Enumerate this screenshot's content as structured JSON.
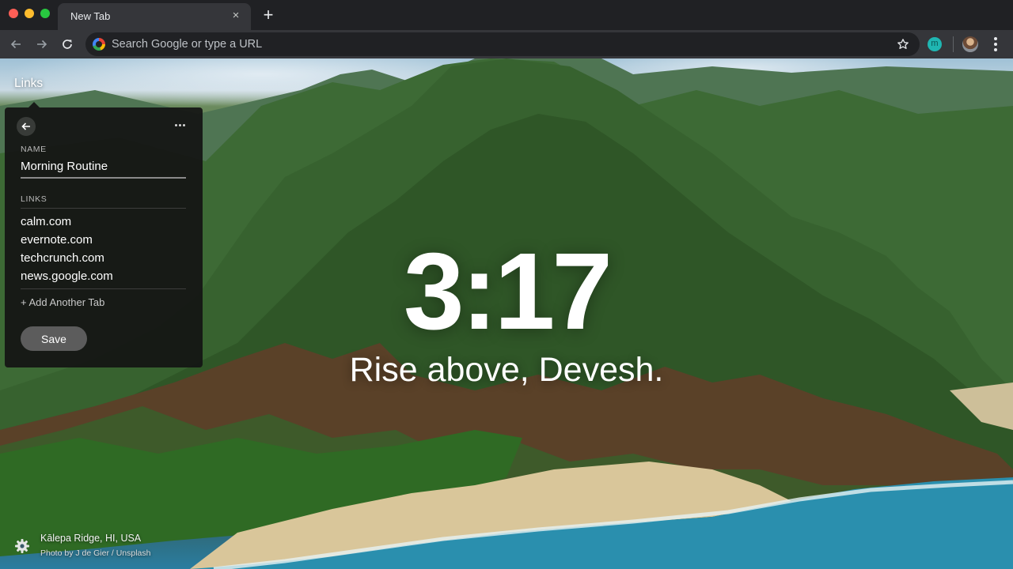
{
  "browser": {
    "tab": {
      "title": "New Tab",
      "close_glyph": "×"
    },
    "new_tab_glyph": "+",
    "omnibox": {
      "placeholder": "Search Google or type a URL",
      "value": ""
    },
    "extension_letter": "m",
    "icons": {
      "back": "arrow-left-icon",
      "forward": "arrow-right-icon",
      "reload": "reload-icon",
      "bookmark": "star-icon",
      "menu": "kebab-menu-icon"
    },
    "colors": {
      "tabstrip": "#202124",
      "toolbar": "#35363a",
      "extension": "#1fb6b2"
    }
  },
  "links_widget": {
    "label": "Links",
    "name_section_label": "NAME",
    "name_value": "Morning Routine",
    "links_section_label": "LINKS",
    "links": [
      {
        "label": "calm.com"
      },
      {
        "label": "evernote.com"
      },
      {
        "label": "techcrunch.com"
      },
      {
        "label": "news.google.com"
      }
    ],
    "add_tab_label": "+ Add Another Tab",
    "save_label": "Save",
    "more_glyph": "•••"
  },
  "center": {
    "time": "3:17",
    "greeting": "Rise above, Devesh."
  },
  "footer": {
    "location": "Kālepa Ridge, HI, USA",
    "credit": "Photo by J de Gier / Unsplash",
    "settings_icon": "gear-icon"
  }
}
